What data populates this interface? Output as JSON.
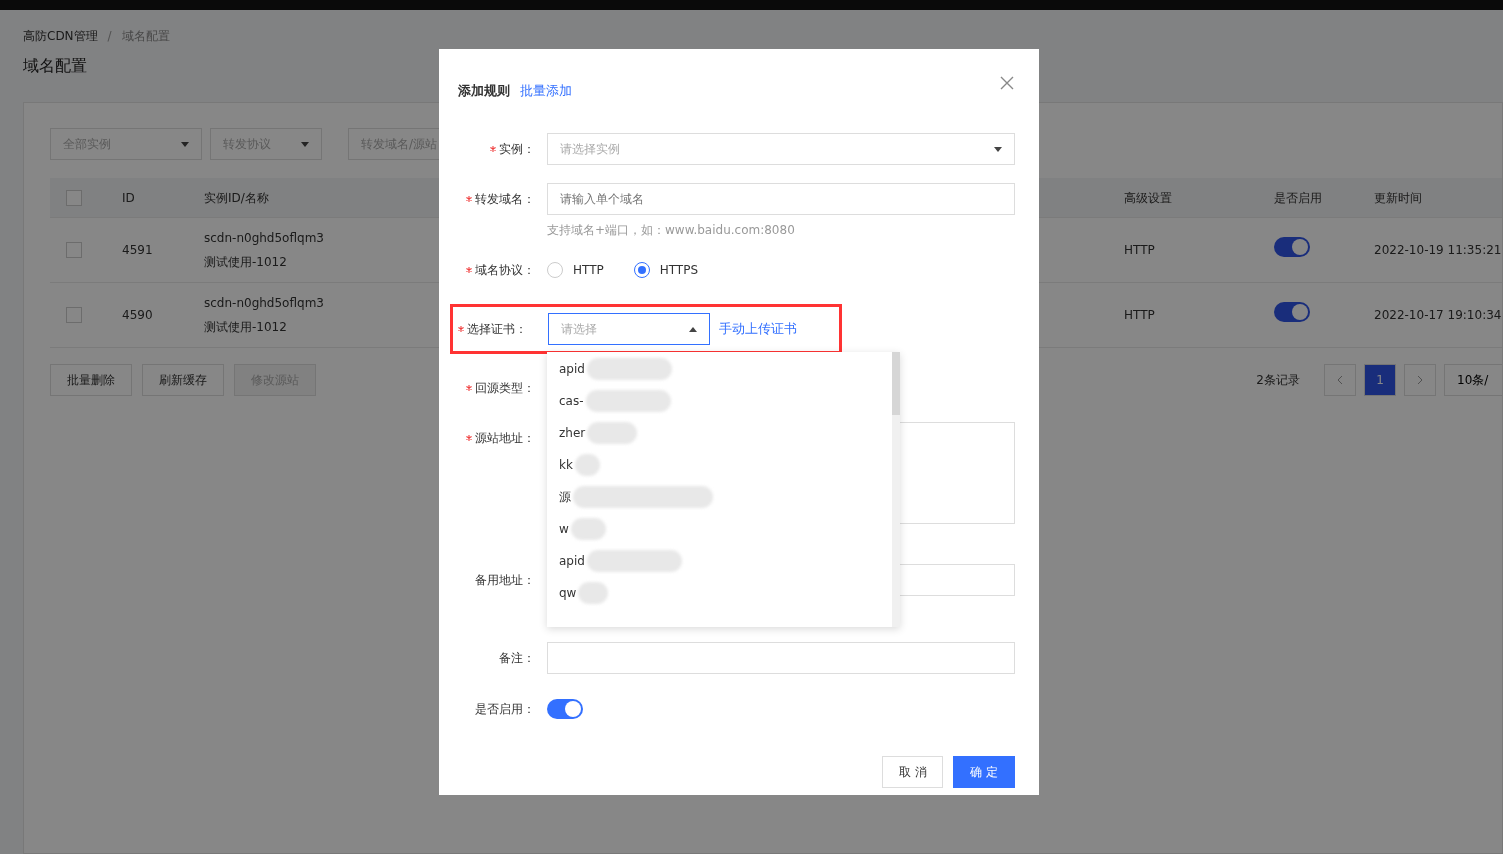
{
  "breadcrumb_separator": "/",
  "breadcrumb": [
    {
      "label": "高防CDN管理",
      "selected": false
    },
    {
      "label": "域名配置",
      "selected": true
    }
  ],
  "page_title": "域名配置",
  "filters": [
    {
      "kind": "select",
      "placeholder": "全部实例"
    },
    {
      "kind": "select",
      "placeholder": "转发协议"
    },
    {
      "kind": "input",
      "placeholder": "转发域名/源站"
    }
  ],
  "table": {
    "header_checked": false,
    "columns": [
      {
        "label": "ID"
      },
      {
        "label": "实例ID/名称"
      },
      {
        "label": "高级设置"
      },
      {
        "label": "是否启用"
      },
      {
        "label": "更新时间"
      }
    ],
    "rows": [
      {
        "checked": false,
        "id": "4591",
        "instance_id": "scdn-n0ghd5oflqm3",
        "instance_name": "测试使用-1012",
        "advanced": "HTTP",
        "enabled": true,
        "updated": "2022-10-19 11:35:21"
      },
      {
        "checked": false,
        "id": "4590",
        "instance_id": "scdn-n0ghd5oflqm3",
        "instance_name": "测试使用-1012",
        "advanced": "HTTP",
        "enabled": true,
        "updated": "2022-10-17 19:10:34"
      }
    ]
  },
  "actions": [
    {
      "label": "批量删除",
      "disabled": false
    },
    {
      "label": "刷新缓存",
      "disabled": false
    },
    {
      "label": "修改源站",
      "disabled": true
    }
  ],
  "pagination": {
    "total": "2条记录",
    "pages": [
      {
        "label": "1",
        "selected": true
      }
    ],
    "page_size": "10条/"
  },
  "modal": {
    "title": "添加规则",
    "link": "批量添加",
    "fields": [
      {
        "kind": "select",
        "label": "实例：",
        "required": true,
        "placeholder": "请选择实例"
      },
      {
        "kind": "input",
        "label": "转发域名：",
        "required": true,
        "placeholder": "请输入单个域名",
        "hint": "支持域名+端口，如：www.baidu.com:8080"
      },
      {
        "kind": "radio",
        "label": "域名协议：",
        "required": true,
        "options": [
          {
            "label": "HTTP",
            "selected": false
          },
          {
            "label": "HTTPS",
            "selected": true
          }
        ]
      },
      {
        "kind": "cert",
        "label": "选择证书：",
        "required": true,
        "placeholder": "请选择",
        "expanded": true,
        "highlighted": true,
        "link": "手动上传证书",
        "options": [
          {
            "label": "apid"
          },
          {
            "label": "cas-"
          },
          {
            "label": "zher"
          },
          {
            "label": "kk"
          },
          {
            "label": "源"
          },
          {
            "label": "w"
          },
          {
            "label": "apid"
          },
          {
            "label": "qw"
          }
        ]
      },
      {
        "kind": "blank",
        "label": "回源类型：",
        "required": true
      },
      {
        "kind": "textarea",
        "label": "源站地址：",
        "required": true
      },
      {
        "kind": "input",
        "label": "备用地址：",
        "required": false
      },
      {
        "kind": "input",
        "label": "备注：",
        "required": false
      },
      {
        "kind": "switch",
        "label": "是否启用：",
        "required": false,
        "on": true
      }
    ],
    "buttons": [
      {
        "label": "取消",
        "kind": "default"
      },
      {
        "label": "确定",
        "kind": "primary"
      }
    ]
  }
}
